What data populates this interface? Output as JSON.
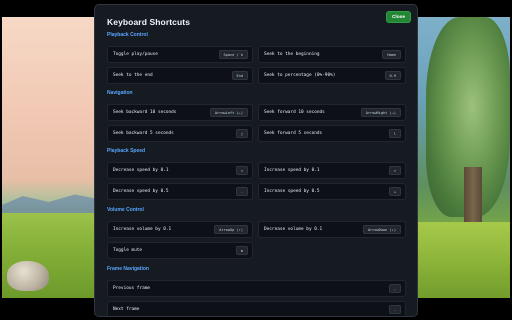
{
  "modal": {
    "title": "Keyboard Shortcuts",
    "close_label": "Close"
  },
  "sections": [
    {
      "title": "Playback Control",
      "items": [
        {
          "desc": "Toggle play/pause",
          "key": "Space / k"
        },
        {
          "desc": "Seek to the beginning",
          "key": "Home"
        },
        {
          "desc": "Seek to the end",
          "key": "End"
        },
        {
          "desc": "Seek to percentage (0%-90%)",
          "key": "0-9"
        }
      ]
    },
    {
      "title": "Navigation",
      "items": [
        {
          "desc": "Seek backward 10 seconds",
          "key": "ArrowLeft (←)"
        },
        {
          "desc": "Seek forward 10 seconds",
          "key": "ArrowRight (→)"
        },
        {
          "desc": "Seek backward 5 seconds",
          "key": "j"
        },
        {
          "desc": "Seek forward 5 seconds",
          "key": "l"
        }
      ]
    },
    {
      "title": "Playback Speed",
      "items": [
        {
          "desc": "Decrease speed by 0.1",
          "key": "<"
        },
        {
          "desc": "Increase speed by 0.1",
          "key": ">"
        },
        {
          "desc": "Decrease speed by 0.5",
          "key": "-"
        },
        {
          "desc": "Increase speed by 0.5",
          "key": "+"
        }
      ]
    },
    {
      "title": "Volume Control",
      "items": [
        {
          "desc": "Increase volume by 0.1",
          "key": "ArrowUp (↑)"
        },
        {
          "desc": "Decrease volume by 0.1",
          "key": "ArrowDown (↓)"
        },
        {
          "desc": "Toggle mute",
          "key": "m"
        }
      ]
    },
    {
      "title": "Frame Navigation",
      "items": [
        {
          "desc": "Previous frame",
          "key": ","
        },
        {
          "desc": "Next frame",
          "key": "."
        }
      ]
    }
  ],
  "colors": {
    "accent": "#58a6ff",
    "close_button": "#238636",
    "panel": "#161b22",
    "row": "#0d1117"
  }
}
